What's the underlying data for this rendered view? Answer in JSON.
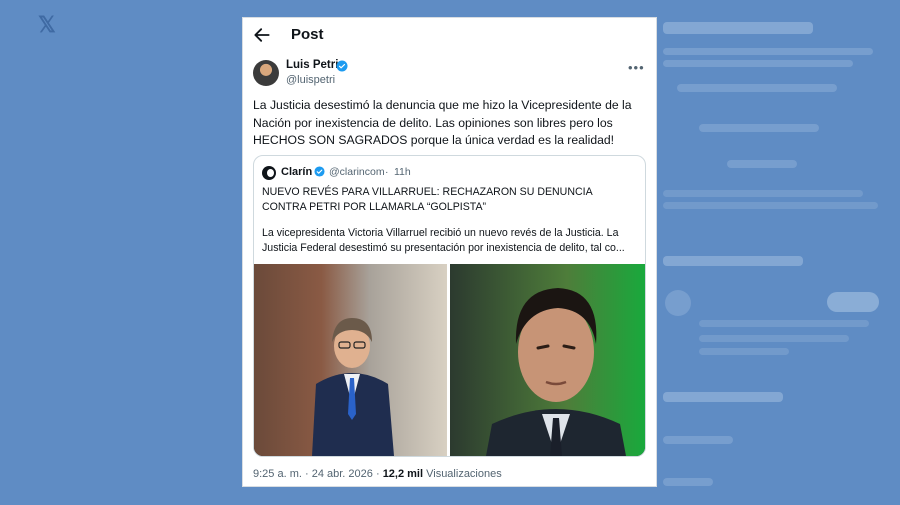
{
  "header": {
    "title": "Post"
  },
  "post": {
    "author_name": "Luis Petri",
    "author_handle": "@luispetri",
    "text": "La Justicia desestimó la denuncia que me hizo la Vicepresidente de la Nación por inexistencia de delito. Las opiniones son libres pero los HECHOS SON SAGRADOS porque la única verdad es la realidad!",
    "time": "9:25 a. m.",
    "separator": "·",
    "date": "24 abr. 2026",
    "views_count": "12,2 mil",
    "views_label": "Visualizaciones"
  },
  "quote": {
    "name": "Clarín",
    "handle": "@clarincom",
    "separator": "·",
    "time": "11h",
    "headline": "NUEVO REVÉS PARA VILLARRUEL: RECHAZARON SU DENUNCIA CONTRA PETRI POR LLAMARLA “GOLPISTA”",
    "body": "La vicepresidenta Victoria Villarruel recibió un nuevo revés de la Justicia. La Justicia Federal desestimó su presentación por inexistencia de delito, tal co..."
  },
  "icons": {
    "back": "arrow-left-icon",
    "more": "more-dots-icon",
    "verified": "verified-badge-icon"
  },
  "colors": {
    "background": "#5f8cc4",
    "verified": "#1d9bf0",
    "text": "#0f1419",
    "secondary": "#536471"
  }
}
